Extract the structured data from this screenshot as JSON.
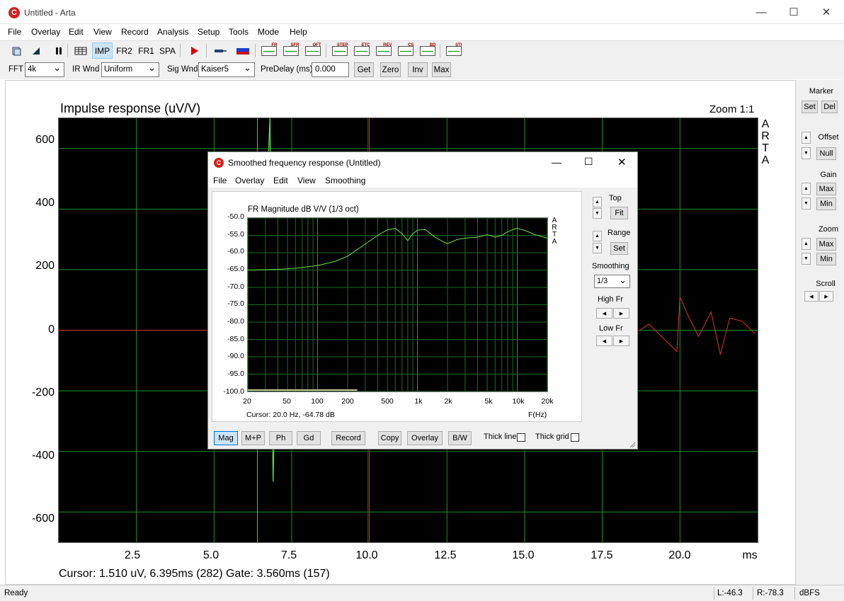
{
  "window": {
    "title": "Untitled - Arta",
    "icon_glyph": "C"
  },
  "menu": [
    "File",
    "Overlay",
    "Edit",
    "View",
    "Record",
    "Analysis",
    "Setup",
    "Tools",
    "Mode",
    "Help"
  ],
  "toolbar": {
    "text_buttons": [
      "IMP",
      "FR2",
      "FR1",
      "SPA"
    ],
    "mini_icons": [
      "FR",
      "SFR",
      "OFT",
      "STEP",
      "ETC",
      "REV",
      "CS",
      "BD",
      "STI"
    ]
  },
  "options": {
    "fft_label": "FFT",
    "fft_value": "4k",
    "irwnd_label": "IR Wnd",
    "irwnd_value": "Uniform",
    "sigwnd_label": "Sig Wnd",
    "sigwnd_value": "Kaiser5",
    "predelay_label": "PreDelay (ms)",
    "predelay_value": "0.000",
    "buttons": [
      "Get",
      "Zero",
      "Inv",
      "Max"
    ]
  },
  "impulse": {
    "title": "Impulse response (uV/V)",
    "zoom": "Zoom 1:1",
    "y_ticks": [
      "600",
      "400",
      "200",
      "0",
      "-200",
      "-400",
      "-600"
    ],
    "x_ticks": [
      "2.5",
      "5.0",
      "7.5",
      "10.0",
      "12.5",
      "15.0",
      "17.5",
      "20.0",
      "ms"
    ],
    "arta_letters": [
      "A",
      "R",
      "T",
      "A"
    ],
    "cursor_text": "Cursor: 1.510 uV, 6.395ms (282)   Gate: 3.560ms (157)"
  },
  "right_panel": {
    "marker": "Marker",
    "set": "Set",
    "del": "Del",
    "offset": "Offset",
    "null": "Null",
    "gain": "Gain",
    "gain_max": "Max",
    "gain_min": "Min",
    "zoom": "Zoom",
    "zoom_max": "Max",
    "zoom_min": "Min",
    "scroll": "Scroll"
  },
  "status": {
    "ready": "Ready",
    "left": "L:-46.3",
    "right": "R:-78.3",
    "unit": "dBFS"
  },
  "dialog": {
    "title": "Smoothed frequency response (Untitled)",
    "icon_glyph": "C",
    "menu": [
      "File",
      "Overlay",
      "Edit",
      "View",
      "Smoothing"
    ],
    "plot_title": "FR Magnitude dB V/V (1/3 oct)",
    "y_ticks": [
      "-50.0",
      "-55.0",
      "-60.0",
      "-65.0",
      "-70.0",
      "-75.0",
      "-80.0",
      "-85.0",
      "-90.0",
      "-95.0",
      "-100.0"
    ],
    "x_ticks": [
      "20",
      "50",
      "100",
      "200",
      "500",
      "1k",
      "2k",
      "5k",
      "10k",
      "20k"
    ],
    "arta_letters": [
      "A",
      "R",
      "T",
      "A"
    ],
    "cursor_text": "Cursor: 20.0 Hz, -64.78 dB",
    "fhz": "F(Hz)",
    "side": {
      "top": "Top",
      "fit": "Fit",
      "range": "Range",
      "set": "Set",
      "smoothing": "Smoothing",
      "smoothing_value": "1/3",
      "high_fr": "High Fr",
      "low_fr": "Low Fr"
    },
    "buttons": [
      "Mag",
      "M+P",
      "Ph",
      "Gd",
      "Record",
      "Copy",
      "Overlay",
      "B/W"
    ],
    "thick_line": "Thick line",
    "thick_grid": "Thick grid"
  },
  "chart_data": [
    {
      "type": "line",
      "title": "Impulse response (uV/V)",
      "xlabel": "ms",
      "ylabel": "",
      "xlim": [
        0,
        22.5
      ],
      "ylim": [
        -700,
        700
      ],
      "grid": true,
      "series": [
        {
          "values": [
            [
              0,
              0
            ],
            [
              6.2,
              0
            ],
            [
              6.5,
              -40
            ],
            [
              6.8,
              700
            ],
            [
              6.9,
              -500
            ],
            [
              7.0,
              -50
            ],
            [
              7.3,
              0
            ],
            [
              18.7,
              0
            ],
            [
              19.0,
              20
            ],
            [
              19.5,
              -30
            ],
            [
              19.9,
              -70
            ],
            [
              20.0,
              110
            ],
            [
              20.3,
              40
            ],
            [
              20.6,
              -20
            ],
            [
              21.0,
              60
            ],
            [
              21.3,
              -80
            ],
            [
              21.6,
              40
            ],
            [
              22.0,
              30
            ],
            [
              22.4,
              -10
            ]
          ]
        }
      ],
      "markers_ms": [
        6.395,
        9.955
      ]
    },
    {
      "type": "line",
      "title": "FR Magnitude dB V/V (1/3 oct)",
      "xlabel": "F(Hz)",
      "ylabel": "",
      "xscale": "log",
      "xlim": [
        20,
        20000
      ],
      "ylim": [
        -100,
        -50
      ],
      "grid": true,
      "series": [
        {
          "x": [
            20,
            40,
            60,
            100,
            150,
            200,
            300,
            400,
            500,
            600,
            700,
            800,
            900,
            1000,
            1200,
            1500,
            1800,
            2000,
            2500,
            3000,
            4000,
            5000,
            6000,
            7000,
            8000,
            9000,
            10000,
            12000,
            15000,
            20000
          ],
          "values": [
            -65,
            -64.8,
            -64.5,
            -63.7,
            -62.5,
            -61,
            -57.5,
            -55,
            -53.4,
            -53,
            -54.5,
            -56.5,
            -54.5,
            -53.5,
            -53.3,
            -55.5,
            -56.8,
            -57.4,
            -56.2,
            -55.8,
            -55.5,
            -54.8,
            -55.5,
            -55,
            -54,
            -53.3,
            -53,
            -53.6,
            -54.8,
            -55.8
          ],
          "color": "#6fdc4a"
        }
      ]
    }
  ]
}
